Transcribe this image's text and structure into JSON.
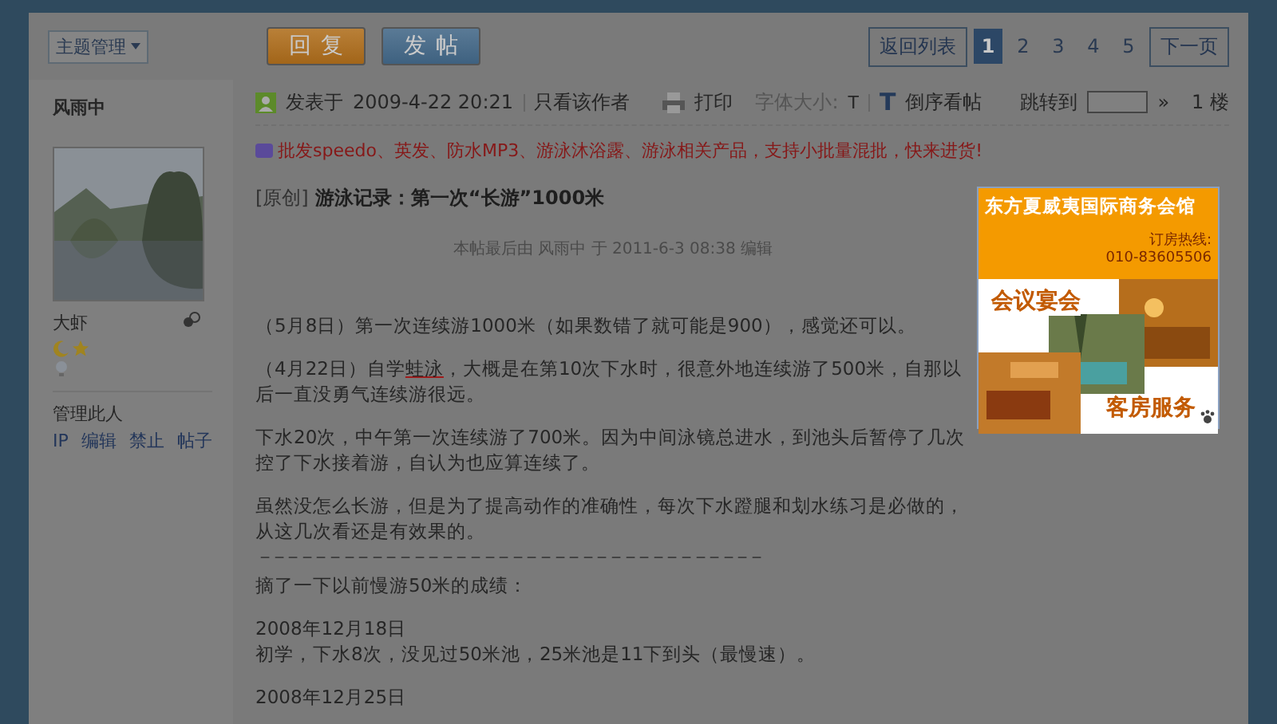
{
  "toolbar": {
    "manage_menu": "主题管理",
    "reply_button": "回复",
    "post_button": "发帖",
    "pager": {
      "back": "返回列表",
      "next": "下一页",
      "pages": [
        {
          "label": "1",
          "selected": true
        },
        {
          "label": "2",
          "selected": false
        },
        {
          "label": "3",
          "selected": false
        },
        {
          "label": "4",
          "selected": false
        },
        {
          "label": "5",
          "selected": false
        }
      ]
    }
  },
  "author": {
    "name": "风雨中",
    "rank": "大虾",
    "manage_label": "管理此人",
    "manage_links": [
      "IP",
      "编辑",
      "禁止",
      "帖子"
    ]
  },
  "post_header": {
    "posted_label": "发表于",
    "posted_time": "2009-4-22 20:21",
    "author_only": "只看该作者",
    "print": "打印",
    "font_size_label": "字体大小:",
    "font_small": "T",
    "font_large": "T",
    "reverse": "倒序看帖",
    "jump_label": "跳转到",
    "jump_go": "»",
    "floor": "1 楼"
  },
  "promo": "批发speedo、英发、防水MP3、游泳沐浴露、游泳相关产品，支持小批量混批，快来进货!",
  "post": {
    "tag": "[原创]",
    "title": "游泳记录：第一次“长游”1000米",
    "edit_note": "本帖最后由 风雨中 于 2011-6-3 08:38 编辑",
    "paragraphs": [
      {
        "kind": "text",
        "text": "（5月8日）第一次连续游1000米（如果数错了就可能是900），感觉还可以。"
      },
      {
        "kind": "linked",
        "before": "（4月22日）自学",
        "link": "蛙泳",
        "after": "，大概是在第10次下水时，很意外地连续游了500米，自那以后一直没勇气连续游很远。"
      },
      {
        "kind": "text",
        "text": "下水20次，中午第一次连续游了700米。因为中间泳镜总进水，到池头后暂停了几次控了下水接着游，自认为也应算连续了。"
      },
      {
        "kind": "text",
        "text": "虽然没怎么长游，但是为了提高动作的准确性，每次下水蹬腿和划水练习是必做的，从这几次看还是有效果的。"
      },
      {
        "kind": "rule",
        "text": "－－－－－－－－－－－－－－－－－－－－－－－－－－－－－－－－－－－－"
      },
      {
        "kind": "text",
        "text": "摘了一下以前慢游50米的成绩："
      },
      {
        "kind": "lines",
        "lines": [
          "2008年12月18日",
          "初学，下水8次，没见过50米池，25米池是11下到头（最慢速）。"
        ]
      },
      {
        "kind": "text",
        "text": "2008年12月25日"
      }
    ]
  },
  "ad": {
    "name": "东方夏威夷国际商务会馆",
    "hotline_label": "订房热线:",
    "hotline": "010-83605506",
    "banquet": "会议宴会",
    "rooms": "客房服务"
  }
}
